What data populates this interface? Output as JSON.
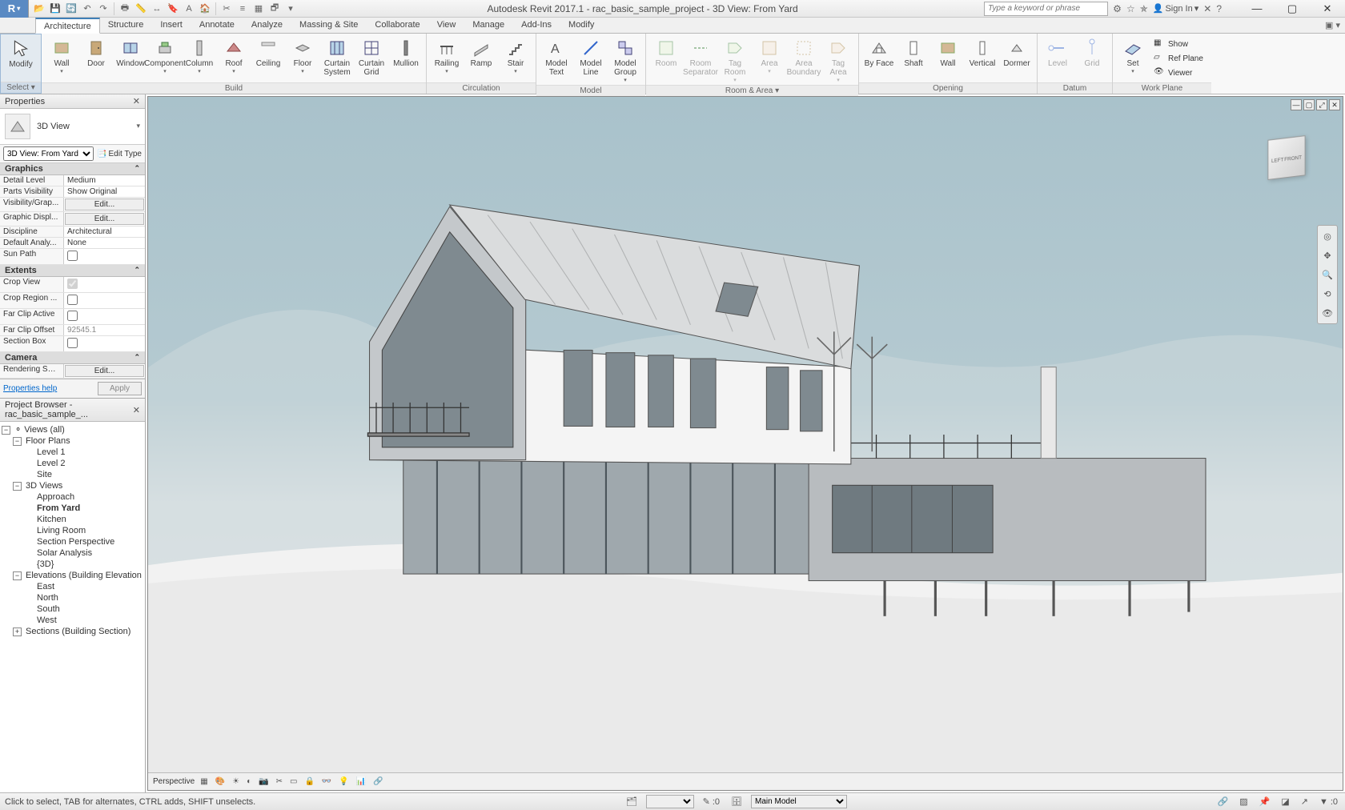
{
  "title": "Autodesk Revit 2017.1 -     rac_basic_sample_project - 3D View: From Yard",
  "search_placeholder": "Type a keyword or phrase",
  "signin": "Sign In",
  "tabs": [
    {
      "label": "Architecture",
      "active": true
    },
    {
      "label": "Structure"
    },
    {
      "label": "Insert"
    },
    {
      "label": "Annotate"
    },
    {
      "label": "Analyze"
    },
    {
      "label": "Massing & Site"
    },
    {
      "label": "Collaborate"
    },
    {
      "label": "View"
    },
    {
      "label": "Manage"
    },
    {
      "label": "Add-Ins"
    },
    {
      "label": "Modify"
    }
  ],
  "ribbon": {
    "select": {
      "title": "Select ▾",
      "items": [
        "Modify"
      ]
    },
    "build": {
      "title": "Build",
      "items": [
        "Wall",
        "Door",
        "Window",
        "Component",
        "Column",
        "Roof",
        "Ceiling",
        "Floor",
        "Curtain System",
        "Curtain Grid",
        "Mullion"
      ]
    },
    "circulation": {
      "title": "Circulation",
      "items": [
        "Railing",
        "Ramp",
        "Stair"
      ]
    },
    "model": {
      "title": "Model",
      "items": [
        "Model Text",
        "Model Line",
        "Model Group"
      ]
    },
    "room": {
      "title": "Room & Area ▾",
      "items": [
        "Room",
        "Room Separator",
        "Tag Room",
        "Area",
        "Area Boundary",
        "Tag Area"
      ]
    },
    "opening": {
      "title": "Opening",
      "items": [
        "By Face",
        "Shaft",
        "Wall",
        "Vertical",
        "Dormer"
      ]
    },
    "datum": {
      "title": "Datum",
      "items": [
        "Level",
        "Grid"
      ]
    },
    "workplane": {
      "title": "Work Plane",
      "set": "Set",
      "sub": [
        "Show",
        "Ref  Plane",
        "Viewer"
      ]
    }
  },
  "properties": {
    "title": "Properties",
    "type_label": "3D View",
    "instance": "3D View: From Yard",
    "edit_type": "Edit Type",
    "help": "Properties help",
    "apply": "Apply",
    "sections": {
      "graphics": {
        "title": "Graphics",
        "rows": [
          {
            "name": "Detail Level",
            "val": "Medium",
            "kind": "drop"
          },
          {
            "name": "Parts Visibility",
            "val": "Show Original",
            "kind": "drop"
          },
          {
            "name": "Visibility/Grap...",
            "val": "Edit...",
            "kind": "btn"
          },
          {
            "name": "Graphic Displ...",
            "val": "Edit...",
            "kind": "btn"
          },
          {
            "name": "Discipline",
            "val": "Architectural",
            "kind": "drop"
          },
          {
            "name": "Default Analy...",
            "val": "None",
            "kind": "drop"
          },
          {
            "name": "Sun Path",
            "val": "",
            "kind": "check",
            "checked": false
          }
        ]
      },
      "extents": {
        "title": "Extents",
        "rows": [
          {
            "name": "Crop View",
            "val": "",
            "kind": "check",
            "checked": true,
            "disabled": true
          },
          {
            "name": "Crop Region ...",
            "val": "",
            "kind": "check",
            "checked": false
          },
          {
            "name": "Far Clip Active",
            "val": "",
            "kind": "check",
            "checked": false
          },
          {
            "name": "Far Clip Offset",
            "val": "92545.1",
            "kind": "text",
            "disabled": true
          },
          {
            "name": "Section Box",
            "val": "",
            "kind": "check",
            "checked": false
          }
        ]
      },
      "camera": {
        "title": "Camera",
        "rows": [
          {
            "name": "Rendering Set...",
            "val": "Edit...",
            "kind": "btn"
          }
        ]
      }
    }
  },
  "browser": {
    "title": "Project Browser - rac_basic_sample_...",
    "root": "Views (all)",
    "floor_plans": {
      "label": "Floor Plans",
      "items": [
        "Level 1",
        "Level 2",
        "Site"
      ]
    },
    "views3d": {
      "label": "3D Views",
      "items": [
        "Approach",
        "From Yard",
        "Kitchen",
        "Living Room",
        "Section Perspective",
        "Solar Analysis",
        "{3D}"
      ],
      "active": "From Yard"
    },
    "elevations": {
      "label": "Elevations (Building Elevation",
      "items": [
        "East",
        "North",
        "South",
        "West"
      ]
    },
    "sections": {
      "label": "Sections (Building Section)"
    }
  },
  "viewcube": {
    "left": "LEFT",
    "front": "FRONT"
  },
  "view_bar": {
    "label": "Perspective"
  },
  "status": {
    "hint": "Click to select, TAB for alternates, CTRL adds, SHIFT unselects.",
    "zero": ":0",
    "main_model": "Main Model",
    "filter_zero": ":0"
  }
}
